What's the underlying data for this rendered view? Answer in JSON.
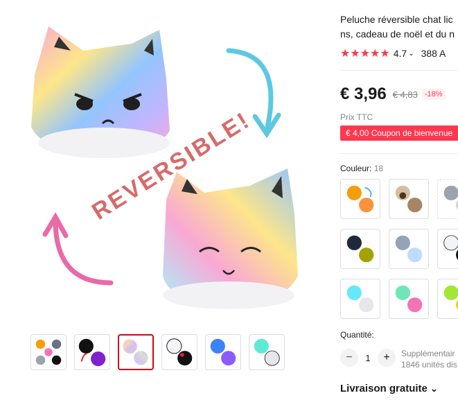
{
  "product": {
    "title_line1": "Peluche réversible chat lic",
    "title_line2": "ns, cadeau de noël et du n",
    "stars": "★★★★★",
    "rating": "4.7",
    "reviews": "388 A",
    "image_text": "REVERSIBLE!"
  },
  "price": {
    "current": "€ 3,96",
    "old": "€ 4,83",
    "discount": "-18%",
    "tax_label": "Prix TTC",
    "coupon": "€ 4,00 Coupon de bienvenue"
  },
  "color": {
    "label": "Couleur: ",
    "count": "18"
  },
  "quantity": {
    "label": "Quantité:",
    "value": "1",
    "minus": "−",
    "plus": "+",
    "stock_line1": "Supplémentair",
    "stock_line2": "1846 unités dis"
  },
  "shipping": {
    "label": "Livraison gratuite"
  },
  "colors": {
    "accent": "#fd384f",
    "active_thumb": "#d0021b"
  }
}
